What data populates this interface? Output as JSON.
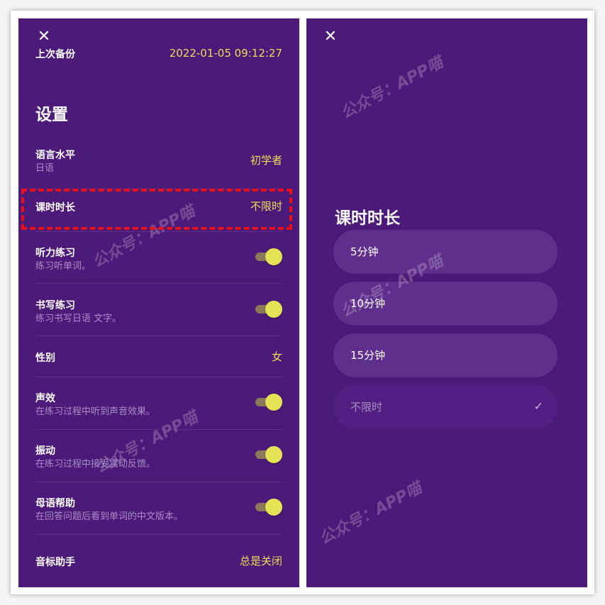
{
  "left": {
    "close_icon": "close-icon",
    "backup_label": "上次备份",
    "backup_time": "2022-01-05 09:12:27",
    "section_title": "设置",
    "rows": {
      "language": {
        "title": "语言水平",
        "subtitle": "日语",
        "value": "初学者"
      },
      "duration": {
        "title": "课时时长",
        "value": "不限时"
      },
      "listening": {
        "title": "听力练习",
        "subtitle": "练习听单词。",
        "toggle_on": true
      },
      "writing": {
        "title": "书写练习",
        "subtitle": "练习书写日语 文字。",
        "toggle_on": true
      },
      "gender": {
        "title": "性别",
        "value": "女"
      },
      "sound": {
        "title": "声效",
        "subtitle": "在练习过程中听到声音效果。",
        "toggle_on": true
      },
      "vibration": {
        "title": "振动",
        "subtitle": "在练习过程中接受震动反馈。",
        "toggle_on": true
      },
      "native_help": {
        "title": "母语帮助",
        "subtitle": "在回答问题后看到单词的中文版本。",
        "toggle_on": true
      },
      "phonetic": {
        "title": "音标助手",
        "value": "总是关闭"
      }
    }
  },
  "right": {
    "close_icon": "close-icon",
    "dialog_title": "课时时长",
    "options": [
      {
        "label": "5分钟",
        "selected": false
      },
      {
        "label": "10分钟",
        "selected": false
      },
      {
        "label": "15分钟",
        "selected": false
      },
      {
        "label": "不限时",
        "selected": true
      }
    ],
    "check_mark": "✓"
  },
  "watermark": "公众号：APP喵",
  "colors": {
    "panel_bg": "#4c1a78",
    "accent_yellow": "#f0dc5a",
    "toggle_knob": "#e4e356",
    "highlight_red": "#e8101a"
  }
}
